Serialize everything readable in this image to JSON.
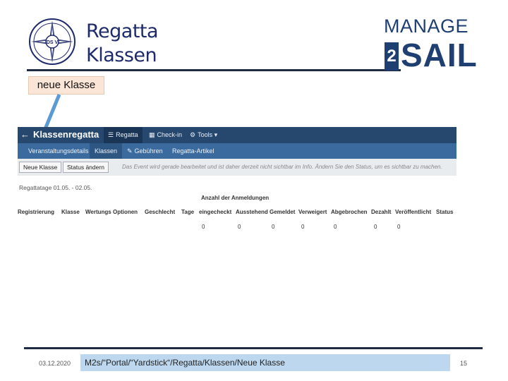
{
  "slide": {
    "title_line1": "Regatta",
    "title_line2": "Klassen",
    "callout": "neue Klasse",
    "brand": {
      "manage": "MANAGE",
      "two": "2",
      "sail": "SAIL"
    },
    "logo_text": "DS V"
  },
  "app": {
    "back": "←",
    "title": "Klassenregatta",
    "top_tabs": [
      {
        "label": "Regatta",
        "icon": "list-icon",
        "active": true
      },
      {
        "label": "Check-in",
        "icon": "calendar-icon",
        "active": false
      },
      {
        "label": "Tools",
        "icon": "gear-icon",
        "active": false,
        "caret": "▾"
      }
    ],
    "sub_tabs": [
      {
        "label": "Veranstaltungsdetails",
        "active": false
      },
      {
        "label": "Klassen",
        "active": true
      },
      {
        "label": "Gebühren",
        "icon": "tag-icon",
        "active": false
      },
      {
        "label": "Regatta-Artikel",
        "active": false
      }
    ],
    "buttons": {
      "new_class": "Neue Klasse",
      "change_status": "Status ändern"
    },
    "notice": "Das Event wird gerade bearbeitet und ist daher derzeit nicht sichtbar im Info. Ändern Sie den Status, um es sichtbar zu machen.",
    "race_dates": "Regattatage 01.05. - 02.05."
  },
  "table": {
    "caption": "Anzahl der Anmeldungen",
    "headers": [
      "Registrierung",
      "Klasse",
      "Wertungs Optionen",
      "Geschlecht",
      "Tage",
      "eingecheckt",
      "Ausstehend",
      "Gemeldet",
      "Verweigert",
      "Abgebrochen",
      "Dezahlt",
      "Veröffentlicht",
      "Status"
    ],
    "values": [
      "0",
      "0",
      "0",
      "0",
      "0",
      "0",
      "0"
    ]
  },
  "footer": {
    "date": "03.12.2020",
    "path": "M2s/“Portal/“Yardstick“/Regatta/Klassen/Neue Klasse",
    "page": "15"
  },
  "colors": {
    "navbar": "#26476e",
    "subbar": "#3b6a9e",
    "callout": "#fbe5d6",
    "footer_path": "#bdd7ee",
    "brand": "#1f3f73"
  }
}
